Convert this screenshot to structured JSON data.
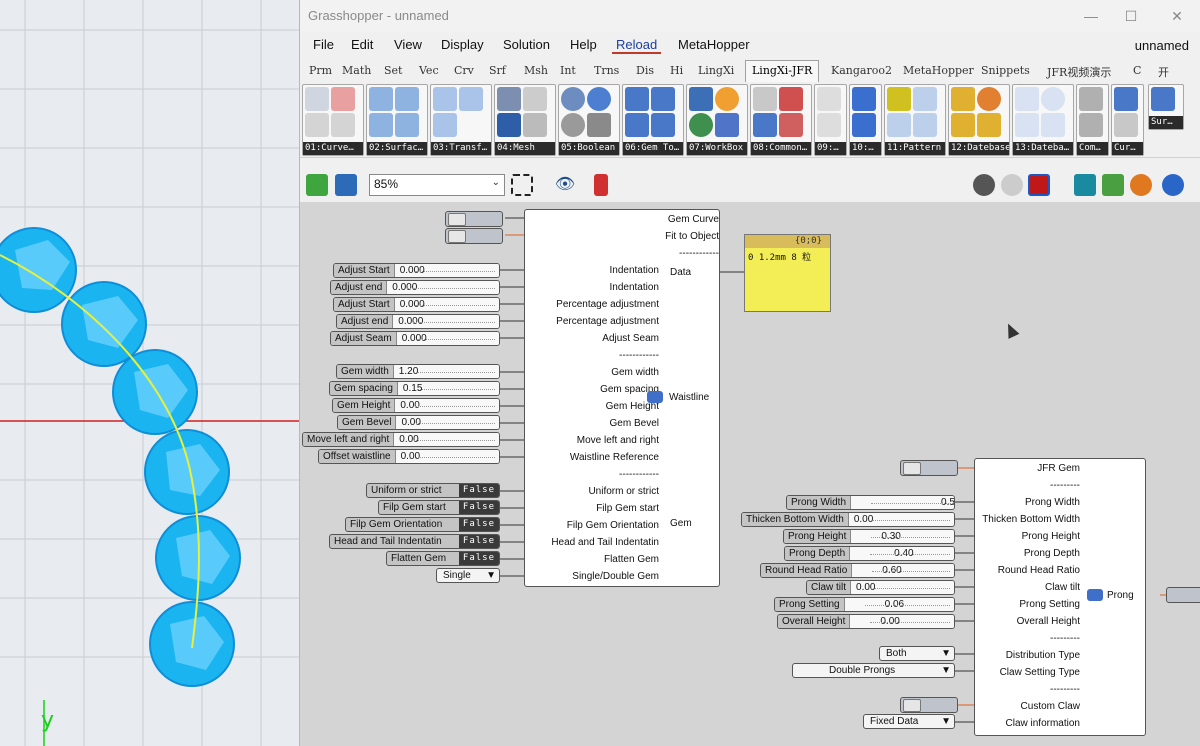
{
  "window": {
    "title": "Grasshopper - unnamed",
    "doc_name": "unnamed",
    "min": "—",
    "max": "☐",
    "close": "✕"
  },
  "menu": [
    "File",
    "Edit",
    "View",
    "Display",
    "Solution",
    "Help",
    "Reload",
    "MetaHopper"
  ],
  "tabs": [
    "Prm",
    "Math",
    "Set",
    "Vec",
    "Crv",
    "Srf",
    "Msh",
    "Int",
    "Trns",
    "Dis",
    "Hi",
    "LingXi",
    "LingXi-JFR",
    "Kangaroo2",
    "MetaHopper",
    "Snippets",
    "JFR视频演示",
    "C",
    "开"
  ],
  "active_tab": "LingXi-JFR",
  "ribbon_panels": [
    "01:Curve…",
    "02:Surfac…",
    "03:Transf…",
    "04:Mesh",
    "05:Boolean",
    "06:Gem To…",
    "07:WorkBox",
    "08:Common…",
    "09:…",
    "10:…",
    "11:Pattern",
    "12:Datebase",
    "13:Dateba…",
    "Com…",
    "Cur…",
    "Sur…"
  ],
  "toolbar": {
    "zoom": "85%"
  },
  "viewport": {
    "axis_label": "y"
  },
  "colors": {
    "gem": "#1ab4f0",
    "gem_dark": "#0f8ed8",
    "curve": "#e8f03a",
    "axis_x": "#d02020",
    "panel": "#f4ee56"
  },
  "gem_component": {
    "inputs": [
      "Gem Curve",
      "Fit to Object",
      "------------",
      "Indentation",
      "Indentation",
      "Percentage adjustment",
      "Percentage adjustment",
      "Adjust Seam",
      "------------",
      "Gem width",
      "Gem spacing",
      "Gem Height",
      "Gem Bevel",
      "Move left and right",
      "Waistline Reference",
      "------------",
      "Uniform or strict",
      "Filp Gem start",
      "Filp Gem Orientation",
      "Head and Tail Indentatin",
      "Flatten Gem",
      "Single/Double Gem"
    ],
    "outputs": [
      "Data",
      "Waistline",
      "Gem"
    ]
  },
  "gem_sliders": [
    {
      "label": "Adjust Start",
      "value": "0.000"
    },
    {
      "label": "Adjust end",
      "value": "0.000"
    },
    {
      "label": "Adjust Start",
      "value": "0.000"
    },
    {
      "label": "Adjust end",
      "value": "0.000"
    },
    {
      "label": "Adjust Seam",
      "value": "0.000"
    },
    {
      "label": "Gem width",
      "value": "1.20"
    },
    {
      "label": "Gem spacing",
      "value": "0.15"
    },
    {
      "label": "Gem Height",
      "value": "0.00"
    },
    {
      "label": "Gem Bevel",
      "value": "0.00"
    },
    {
      "label": "Move left and right",
      "value": "0.00"
    },
    {
      "label": "Offset waistline",
      "value": "0.00"
    }
  ],
  "gem_toggles": [
    {
      "label": "Uniform or strict",
      "value": "False"
    },
    {
      "label": "Filp Gem start",
      "value": "False"
    },
    {
      "label": "Filp Gem Orientation",
      "value": "False"
    },
    {
      "label": "Head and Tail Indentatin",
      "value": "False"
    },
    {
      "label": "Flatten Gem",
      "value": "False"
    }
  ],
  "gem_dropdown": "Single",
  "data_panel": {
    "header": "{0;0}",
    "line": "0 1.2mm 8 粒"
  },
  "prong_component": {
    "inputs": [
      "JFR Gem",
      "---------",
      "Prong Width",
      "Thicken Bottom Width",
      "Prong Height",
      "Prong Depth",
      "Round Head Ratio",
      "Claw tilt",
      "Prong Setting",
      "Overall Height",
      "---------",
      "Distribution Type",
      "Claw Setting Type",
      "---------",
      "Custom Claw",
      "Claw information"
    ],
    "output": "Prong"
  },
  "prong_sliders": [
    {
      "label": "Prong Width",
      "value": "0.50"
    },
    {
      "label": "Thicken Bottom Width",
      "value": "0.00"
    },
    {
      "label": "Prong Height",
      "value": "0.30"
    },
    {
      "label": "Prong Depth",
      "value": "0.40"
    },
    {
      "label": "Round Head Ratio",
      "value": "0.60"
    },
    {
      "label": "Claw tilt",
      "value": "0.00"
    },
    {
      "label": "Prong Setting",
      "value": "0.06"
    },
    {
      "label": "Overall Height",
      "value": "0.00"
    }
  ],
  "prong_dropdowns": [
    "Both",
    "Double Prongs",
    "Fixed Data"
  ]
}
